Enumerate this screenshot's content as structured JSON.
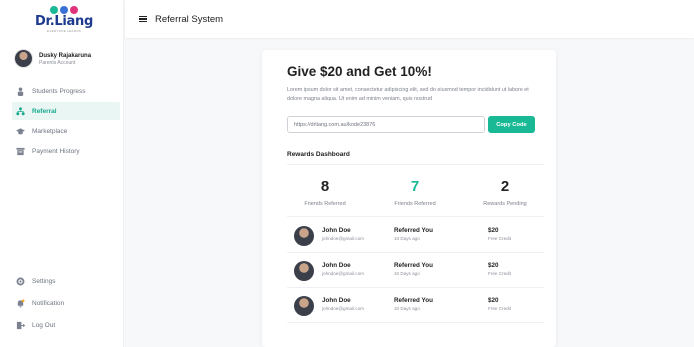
{
  "brand": {
    "name": "Dr.Liang",
    "tagline": "EVERYONE LEARNS",
    "dot_colors": [
      "#1ab995",
      "#3a6fd8",
      "#e0347a"
    ]
  },
  "user": {
    "name": "Dusky Rajakaruna",
    "role": "Parents Account"
  },
  "nav": {
    "items": [
      {
        "label": "Students Progress",
        "icon": "students-icon",
        "active": false
      },
      {
        "label": "Referral",
        "icon": "referral-icon",
        "active": true
      },
      {
        "label": "Marketplace",
        "icon": "graduation-cap-icon",
        "active": false
      },
      {
        "label": "Payment History",
        "icon": "payment-icon",
        "active": false
      }
    ],
    "bottom": [
      {
        "label": "Settings",
        "icon": "gear-icon"
      },
      {
        "label": "Notification",
        "icon": "bell-icon"
      },
      {
        "label": "Log Out",
        "icon": "logout-icon"
      }
    ]
  },
  "header": {
    "title": "Referral System"
  },
  "referral": {
    "headline": "Give $20 and Get 10%!",
    "description": "Lorem ipsum dolor sit amet, consectetur adipiscing elit, sed do eiusmod tempor incididunt ut labore et dolore magna aliqua. Ut enim ad minim veniam, quis nostrud",
    "link_value": "https://drliang.com.au/kode23876",
    "copy_label": "Copy Code",
    "dashboard_title": "Rewards Dashboard",
    "stats": [
      {
        "value": "8",
        "label": "Friends Referred"
      },
      {
        "value": "7",
        "label": "Friends Referred"
      },
      {
        "value": "2",
        "label": "Rewards Pending"
      }
    ],
    "rows": [
      {
        "name": "John Doe",
        "email": "johndoe@gmail.com",
        "status": "Referred You",
        "when": "10 Days ago",
        "amount": "$20",
        "reward": "Free Credit"
      },
      {
        "name": "John Doe",
        "email": "johndoe@gmail.com",
        "status": "Referred You",
        "when": "10 Days ago",
        "amount": "$20",
        "reward": "Free Credit"
      },
      {
        "name": "John Doe",
        "email": "johndoe@gmail.com",
        "status": "Referred You",
        "when": "10 Days ago",
        "amount": "$20",
        "reward": "Free Credit"
      }
    ]
  },
  "colors": {
    "accent": "#1ab995",
    "brand_blue": "#1f3b8f",
    "active_bg": "#e9f6f3"
  }
}
